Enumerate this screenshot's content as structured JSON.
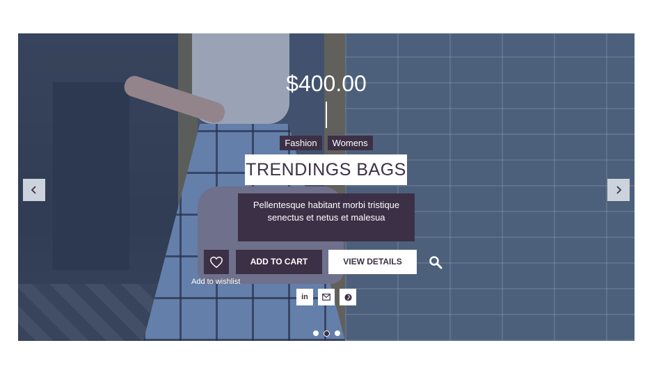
{
  "slide": {
    "price": "$400.00",
    "tags": [
      "Fashion",
      "Womens"
    ],
    "title": "TRENDINGS BAGS",
    "description": "Pellentesque habitant morbi tristique senectus et netus et malesua",
    "add_to_cart": "ADD TO CART",
    "view_details": "VIEW DETAILS",
    "wishlist_label": "Add to wishlist"
  },
  "share": {
    "linkedin": "in"
  },
  "pagination": {
    "count": 3,
    "active_index": 1
  },
  "colors": {
    "accent": "#3c3046",
    "white": "#ffffff",
    "arrow_bg": "#cdd3dc"
  },
  "icons": [
    "chevron-left-icon",
    "chevron-right-icon",
    "heart-icon",
    "search-icon",
    "linkedin-icon",
    "envelope-icon",
    "pinterest-icon"
  ]
}
